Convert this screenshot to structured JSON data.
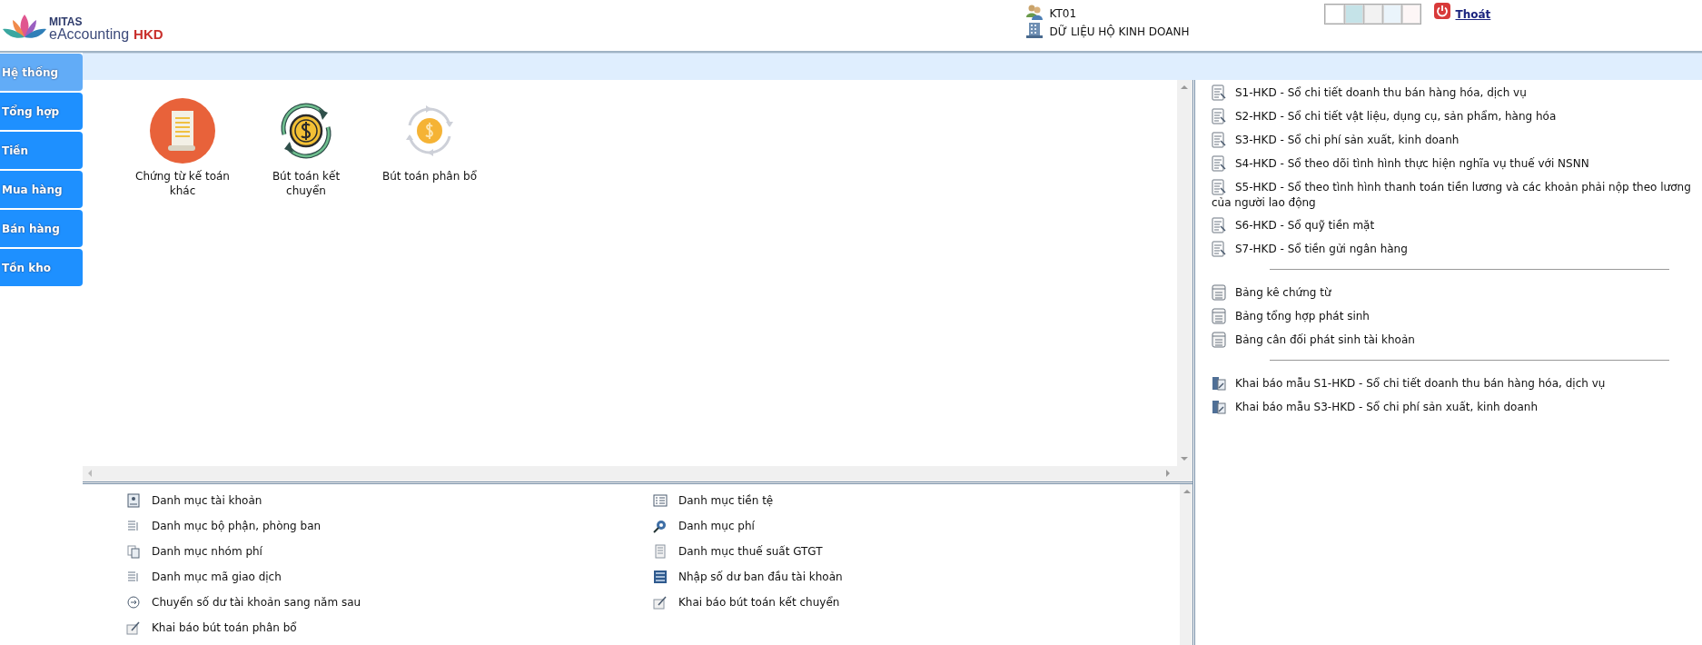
{
  "logo": {
    "brand": "MITAS",
    "product": "eAccounting",
    "edition": "HKD"
  },
  "header": {
    "user": "KT01",
    "database": "DỮ LIỆU HỘ KINH DOANH",
    "logout": "Thoát",
    "theme_swatches": [
      {
        "color": "#ffffff"
      },
      {
        "color": "#c5e3e8"
      },
      {
        "color": "#f2f2f2"
      },
      {
        "color": "#eaf4fb"
      },
      {
        "color": "#fdf6f6"
      }
    ]
  },
  "sidebar": {
    "items": [
      {
        "label": "Hệ thống",
        "selected": true
      },
      {
        "label": "Tổng hợp",
        "selected": false
      },
      {
        "label": "Tiền",
        "selected": false
      },
      {
        "label": "Mua hàng",
        "selected": false
      },
      {
        "label": "Bán hàng",
        "selected": false
      },
      {
        "label": "Tồn kho",
        "selected": false
      }
    ]
  },
  "shortcuts": [
    {
      "label": "Chứng từ kế toán khác",
      "kind": "document"
    },
    {
      "label": "Bút toán kết chuyển",
      "kind": "transfer"
    },
    {
      "label": "Bút toán phân bổ",
      "kind": "allocation"
    }
  ],
  "catalog": {
    "columns": [
      {
        "items": [
          {
            "label": "Danh mục tài khoản",
            "kind": "account"
          },
          {
            "label": "Danh mục bộ phận, phòng ban",
            "kind": "list"
          },
          {
            "label": "Danh mục nhóm phí",
            "kind": "group"
          },
          {
            "label": "Danh mục mã giao dịch",
            "kind": "list"
          },
          {
            "label": "Chuyển số dư tài khoản sang năm sau",
            "kind": "carry"
          },
          {
            "label": "Khai báo bút toán phân bổ",
            "kind": "entry"
          }
        ]
      },
      {
        "items": [
          {
            "label": "Danh mục tiền tệ",
            "kind": "currency"
          },
          {
            "label": "Danh mục phí",
            "kind": "fee"
          },
          {
            "label": "Danh mục thuế suất GTGT",
            "kind": "tax"
          },
          {
            "label": "Nhập số dư ban đầu tài khoản",
            "kind": "balance"
          },
          {
            "label": "Khai báo bút toán kết chuyển",
            "kind": "entry"
          }
        ]
      }
    ]
  },
  "reports": {
    "groups": [
      {
        "kind": "ledger",
        "items": [
          "S1-HKD - Sổ chi tiết doanh thu bán hàng hóa, dịch vụ",
          "S2-HKD - Sổ chi tiết vật liệu, dụng cụ, sản phẩm, hàng hóa",
          "S3-HKD - Sổ chi phí sản xuất, kinh doanh",
          "S4-HKD - Sổ theo dõi tình hình thực hiện nghĩa vụ thuế với NSNN",
          "S5-HKD - Sổ theo tình hình thanh toán tiền lương và các khoản phải nộp theo lương của người lao động",
          "S6-HKD - Sổ quỹ tiền mặt",
          "S7-HKD - Sổ tiền gửi ngân hàng"
        ]
      },
      {
        "kind": "table",
        "items": [
          "Bảng kê chứng từ",
          "Bảng tổng hợp phát sinh",
          "Bảng cân đối phát sinh tài khoản"
        ]
      },
      {
        "kind": "template",
        "items": [
          "Khai báo mẫu S1-HKD - Sổ chi tiết doanh thu bán hàng hóa, dịch vụ",
          "Khai báo mẫu S3-HKD - Sổ chi phí sản xuất, kinh doanh"
        ]
      }
    ]
  }
}
